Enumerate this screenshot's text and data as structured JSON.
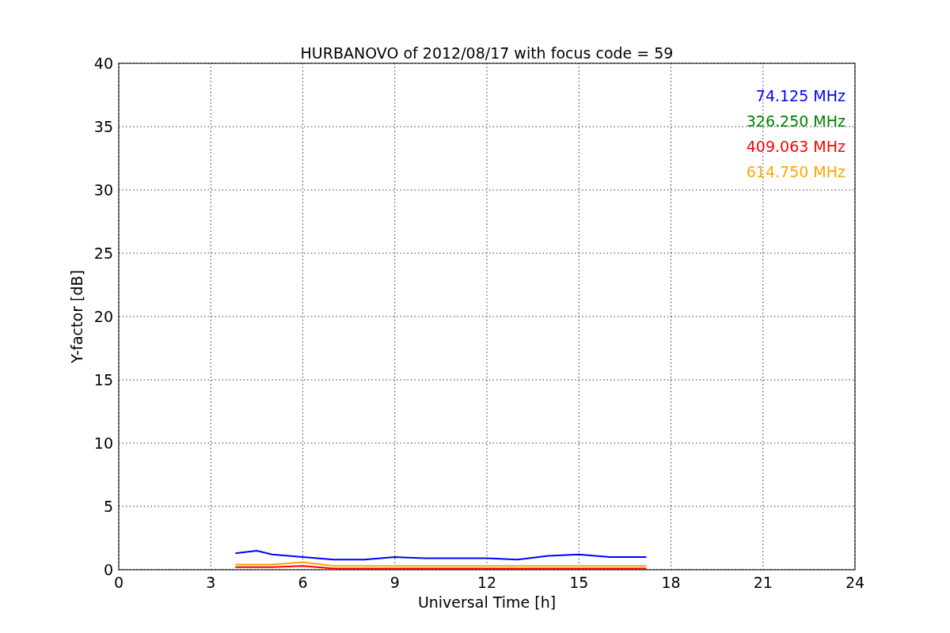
{
  "chart_data": {
    "type": "line",
    "title": "HURBANOVO of 2012/08/17 with focus code = 59",
    "xlabel": "Universal Time [h]",
    "ylabel": "Y-factor [dB]",
    "x": [
      3.8,
      4.5,
      5,
      6,
      7,
      8,
      9,
      10,
      11,
      12,
      13,
      14,
      15,
      16,
      17,
      17.2
    ],
    "grid": true,
    "xlim": [
      0,
      24
    ],
    "ylim": [
      0,
      40
    ],
    "xticks": [
      0,
      3,
      6,
      9,
      12,
      15,
      18,
      21,
      24
    ],
    "yticks": [
      0,
      5,
      10,
      15,
      20,
      25,
      30,
      35,
      40
    ],
    "series": [
      {
        "name": "74.125 MHz",
        "color": "#0000ff",
        "values": [
          1.3,
          1.5,
          1.2,
          1.0,
          0.8,
          0.8,
          1.0,
          0.9,
          0.9,
          0.9,
          0.8,
          1.1,
          1.2,
          1.0,
          1.0,
          1.0
        ]
      },
      {
        "name": "326.250 MHz",
        "color": "#008000",
        "values": [
          null,
          null,
          null,
          null,
          null,
          null,
          null,
          null,
          null,
          null,
          null,
          null,
          null,
          null,
          null,
          null
        ]
      },
      {
        "name": "409.063 MHz",
        "color": "#ff0000",
        "values": [
          0.2,
          0.2,
          0.2,
          0.3,
          0.1,
          0.1,
          0.1,
          0.1,
          0.1,
          0.1,
          0.1,
          0.1,
          0.1,
          0.1,
          0.1,
          0.1
        ]
      },
      {
        "name": "614.750 MHz",
        "color": "#ffa500",
        "values": [
          0.4,
          0.4,
          0.4,
          0.6,
          0.3,
          0.3,
          0.3,
          0.3,
          0.3,
          0.3,
          0.3,
          0.3,
          0.3,
          0.3,
          0.3,
          0.3
        ]
      }
    ]
  }
}
